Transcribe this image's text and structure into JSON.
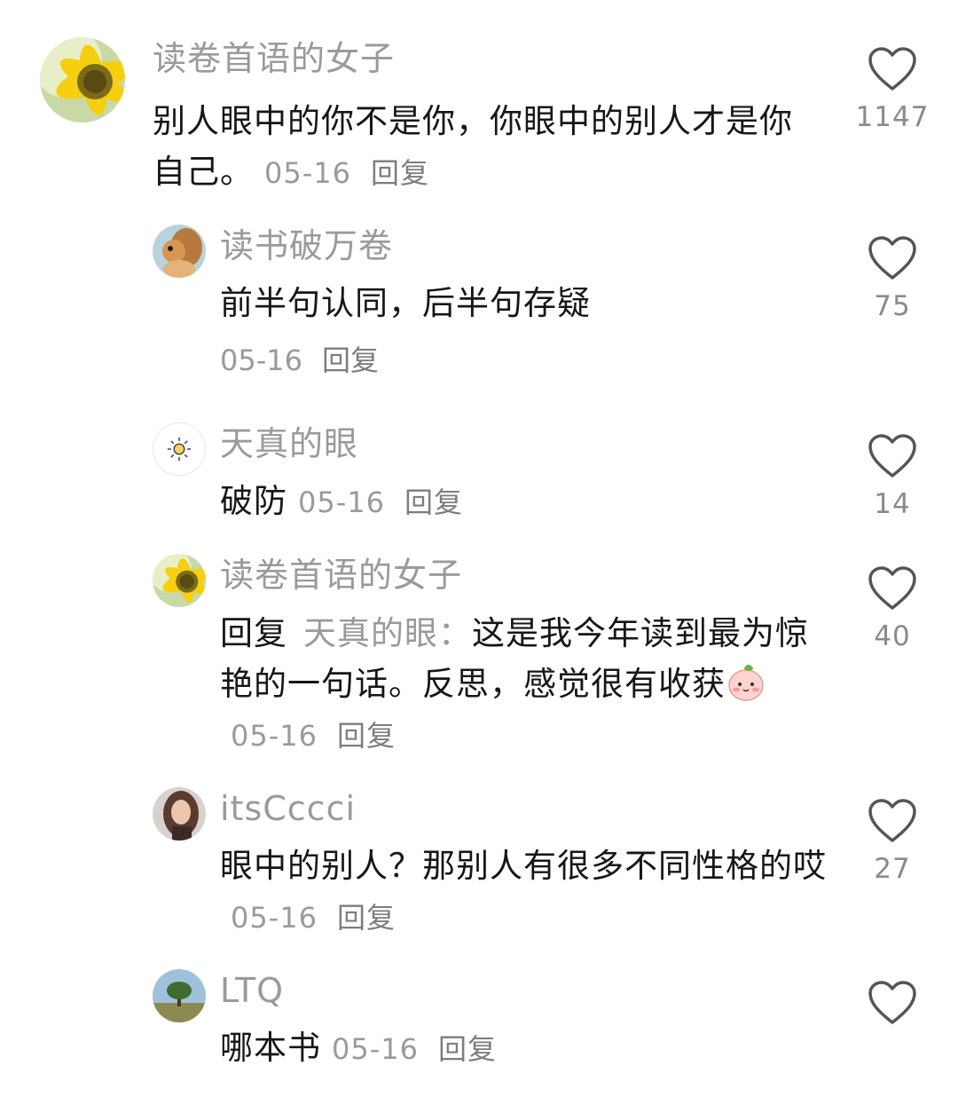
{
  "comments": [
    {
      "author": "读卷首语的女子",
      "text": "别人眼中的你不是你，你眼中的别人才是你自己。",
      "date": "05-16",
      "reply_label": "回复",
      "likes": "1147",
      "avatar_icon": "sunflower-avatar"
    },
    {
      "author": "读书破万卷",
      "text": "前半句认同，后半句存疑",
      "date": "05-16",
      "reply_label": "回复",
      "likes": "75",
      "avatar_icon": "squirrel-avatar"
    },
    {
      "author": "天真的眼",
      "text": "破防",
      "date": "05-16",
      "reply_label": "回复",
      "likes": "14",
      "avatar_icon": "sun-avatar"
    },
    {
      "author": "读卷首语的女子",
      "reply_prefix": "回复",
      "reply_target": "天真的眼：",
      "text": "这是我今年读到最为惊艳的一句话。反思，感觉很有收获",
      "date": "05-16",
      "reply_label": "回复",
      "likes": "40",
      "avatar_icon": "sunflower-avatar",
      "emoji_icon": "peach-face-emoji"
    },
    {
      "author": "itsCccci",
      "text": "眼中的别人？那别人有很多不同性格的哎",
      "date": "05-16",
      "reply_label": "回复",
      "likes": "27",
      "avatar_icon": "portrait-avatar"
    },
    {
      "author": "LTQ",
      "text": "哪本书",
      "date": "05-16",
      "reply_label": "回复",
      "likes": "",
      "avatar_icon": "tree-landscape-avatar"
    }
  ],
  "colors": {
    "author": "#9a9a9a",
    "text": "#161616",
    "like_outline": "#555555"
  }
}
